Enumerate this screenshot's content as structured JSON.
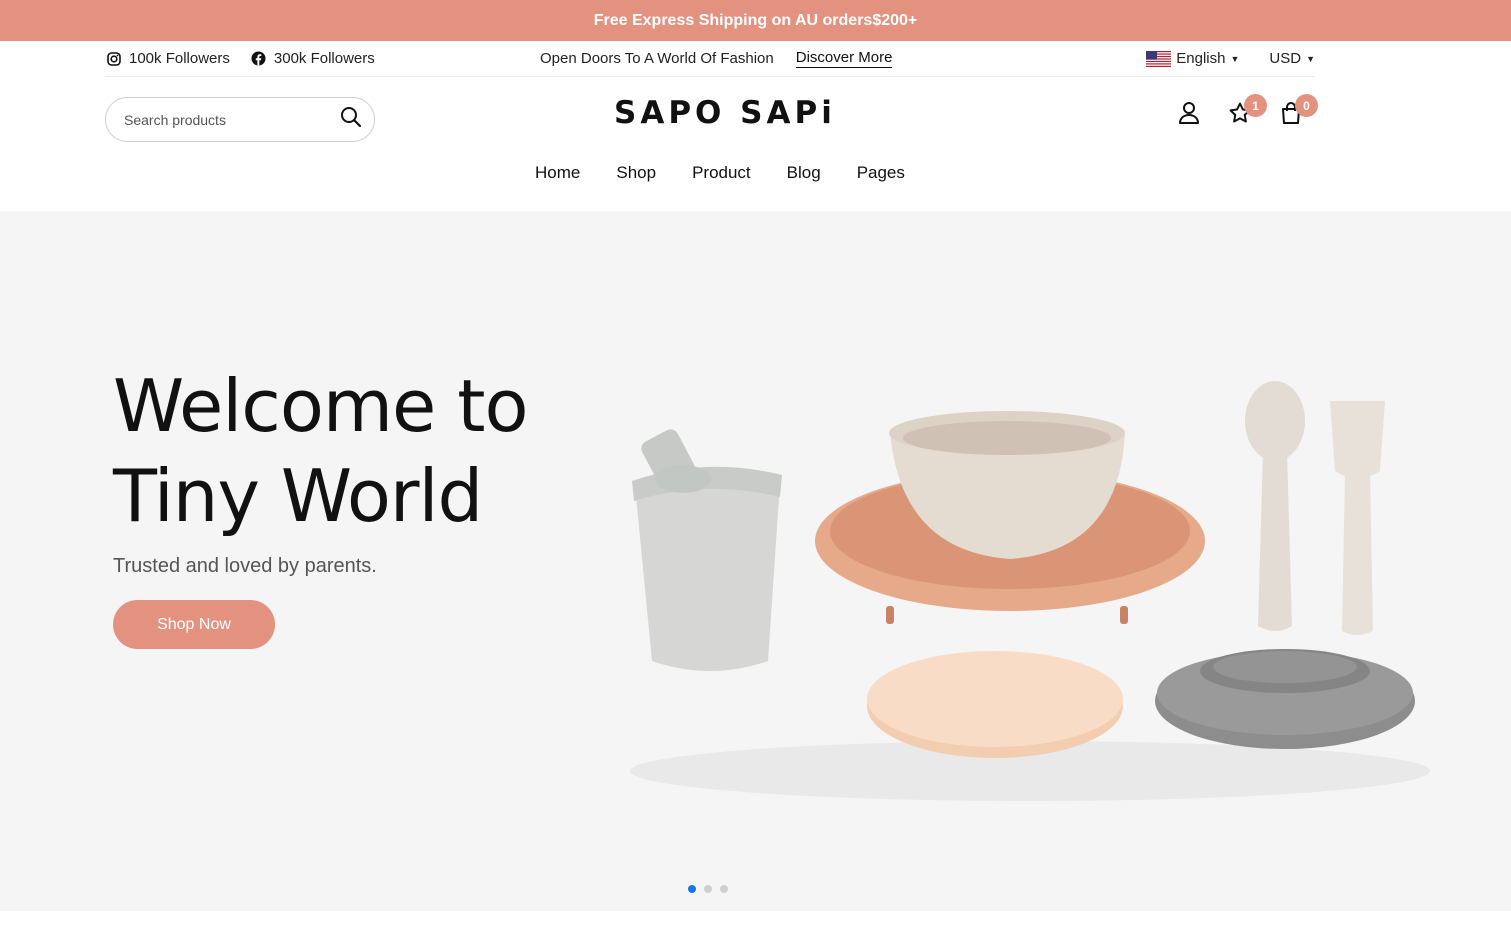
{
  "announcement": "Free Express Shipping on AU orders$200+",
  "topbar": {
    "instagram": "100k Followers",
    "facebook": "300k Followers",
    "message": "Open Doors To A World Of Fashion",
    "discover": "Discover More",
    "language": "English",
    "currency": "USD"
  },
  "search": {
    "placeholder": "Search products"
  },
  "logo": "SAPO SAPi",
  "badges": {
    "wishlist": "1",
    "cart": "0"
  },
  "nav": [
    "Home",
    "Shop",
    "Product",
    "Blog",
    "Pages"
  ],
  "hero": {
    "title": "Welcome to Tiny World",
    "subtitle": "Trusted and loved by parents.",
    "button": "Shop Now",
    "slides": 3,
    "active_slide": 1
  },
  "colors": {
    "accent": "#e2927f",
    "hero_bg": "#f5f5f5",
    "active_dot": "#1976f0"
  }
}
